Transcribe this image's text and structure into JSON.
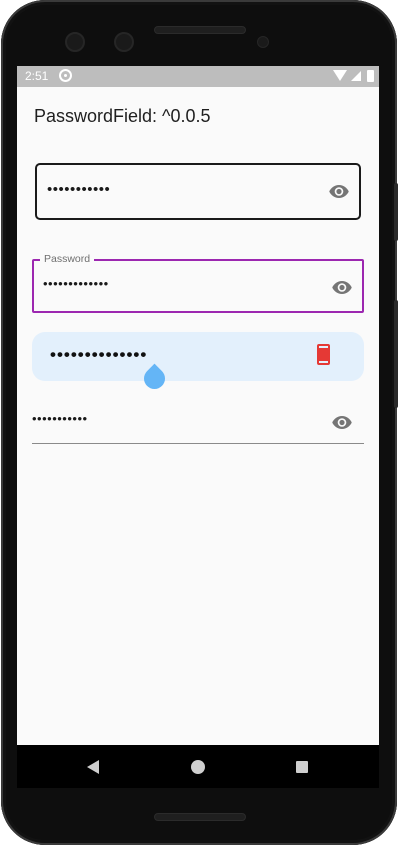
{
  "status_bar": {
    "time": "2:51"
  },
  "app": {
    "title": "PasswordField: ^0.0.5"
  },
  "fields": {
    "outlined_black": {
      "value": "•••••••••••",
      "suffix_icon": "eye-icon"
    },
    "outlined_purple": {
      "label": "Password",
      "value": "•••••••••••••",
      "suffix_icon": "eye-icon",
      "accent": "#9c27b0"
    },
    "filled_blue": {
      "value": "••••••••••••••",
      "suffix_icon": "smartphone-icon",
      "fill": "#e3f0fc",
      "icon_color": "#e53935",
      "cursor_handle_color": "#64b5f6"
    },
    "underline": {
      "value": "•••••••••••",
      "suffix_icon": "eye-icon"
    }
  },
  "nav_bar": {
    "buttons": [
      "back-icon",
      "home-icon",
      "recents-icon"
    ]
  }
}
